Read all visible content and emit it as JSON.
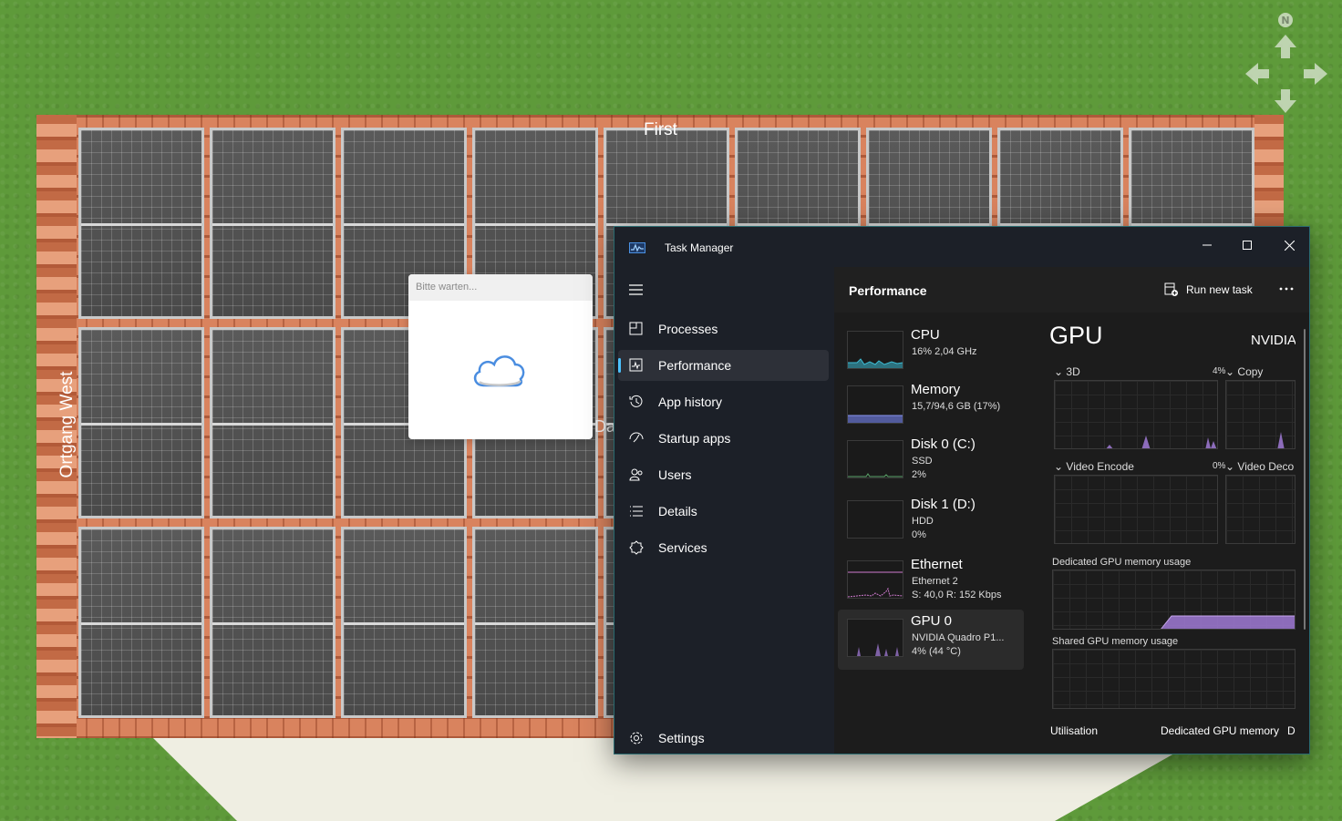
{
  "scene": {
    "label_top": "First",
    "label_left": "Ortgang West",
    "label_hidden": "Da",
    "compass_label": "N"
  },
  "wait_dialog": {
    "title": "Bitte warten...",
    "icon": "cloud-icon"
  },
  "task_manager": {
    "window_title": "Task Manager",
    "sidebar": {
      "items": [
        {
          "label": "Processes",
          "icon": "processes-icon"
        },
        {
          "label": "Performance",
          "icon": "performance-icon",
          "active": true
        },
        {
          "label": "App history",
          "icon": "history-icon"
        },
        {
          "label": "Startup apps",
          "icon": "startup-icon"
        },
        {
          "label": "Users",
          "icon": "users-icon"
        },
        {
          "label": "Details",
          "icon": "details-icon"
        },
        {
          "label": "Services",
          "icon": "services-icon"
        }
      ],
      "settings_label": "Settings"
    },
    "header": {
      "title": "Performance",
      "run_new_task": "Run new task"
    },
    "resources": [
      {
        "name": "CPU",
        "line1": "16% 2,04 GHz",
        "line2": ""
      },
      {
        "name": "Memory",
        "line1": "15,7/94,6 GB (17%)",
        "line2": ""
      },
      {
        "name": "Disk 0 (C:)",
        "line1": "SSD",
        "line2": "2%"
      },
      {
        "name": "Disk 1 (D:)",
        "line1": "HDD",
        "line2": "0%"
      },
      {
        "name": "Ethernet",
        "line1": "Ethernet 2",
        "line2": "S: 40,0 R: 152 Kbps"
      },
      {
        "name": "GPU 0",
        "line1": "NVIDIA Quadro P1...",
        "line2": "4% (44 °C)",
        "active": true
      }
    ],
    "gpu": {
      "title": "GPU",
      "vendor": "NVIDIA",
      "engines": [
        {
          "label": "3D",
          "pct": "4%"
        },
        {
          "label": "Copy",
          "pct": ""
        },
        {
          "label": "Video Encode",
          "pct": "0%"
        },
        {
          "label": "Video Deco",
          "pct": ""
        }
      ],
      "dedicated_label": "Dedicated GPU memory usage",
      "shared_label": "Shared GPU memory usage",
      "bottom_utilisation": "Utilisation",
      "bottom_dedicated": "Dedicated GPU memory",
      "bottom_more": "D"
    },
    "colors": {
      "cpu": "#3dbcd4",
      "memory": "#6b78d6",
      "disk": "#5aa469",
      "ethernet": "#d07ad0",
      "gpu": "#a07ad6",
      "accent": "#4cc2ff"
    }
  }
}
